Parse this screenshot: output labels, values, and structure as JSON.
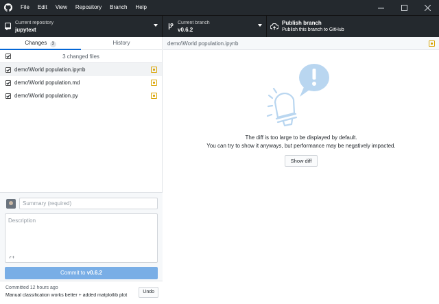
{
  "menu": [
    "File",
    "Edit",
    "View",
    "Repository",
    "Branch",
    "Help"
  ],
  "toolbar": {
    "repo_label": "Current repository",
    "repo_value": "jupytext",
    "branch_label": "Current branch",
    "branch_value": "v0.6.2",
    "publish_label": "Publish branch",
    "publish_desc": "Publish this branch to GitHub"
  },
  "tabs": {
    "changes": "Changes",
    "changes_count": "3",
    "history": "History"
  },
  "changes": {
    "summary": "3 changed files",
    "files": [
      "demo\\World population.ipynb",
      "demo\\World population.md",
      "demo\\World population.py"
    ]
  },
  "commit": {
    "summary_placeholder": "Summary (required)",
    "description_placeholder": "Description",
    "coauthor": "♂+",
    "button_prefix": "Commit to ",
    "button_branch": "v0.6.2"
  },
  "last_commit": {
    "when": "Committed 12 hours ago",
    "message": "Manual classification works better + added matplotlib plot",
    "undo": "Undo"
  },
  "diff": {
    "path": "demo\\World population.ipynb",
    "line1": "The diff is too large to be displayed by default.",
    "line2": "You can try to show it anyways, but performance may be negatively impacted.",
    "show_diff": "Show diff"
  },
  "colors": {
    "titlebar": "#24292e",
    "accent": "#0366d6",
    "commit_button": "#79aee6",
    "modified": "#d9a300",
    "illustration_blue": "#b9d6f0"
  },
  "icons": {
    "app": "github-icon",
    "repo": "repo-icon",
    "branch": "branch-icon",
    "publish": "cloud-upload-icon",
    "illustration": "lightbulb-alert-icon"
  }
}
